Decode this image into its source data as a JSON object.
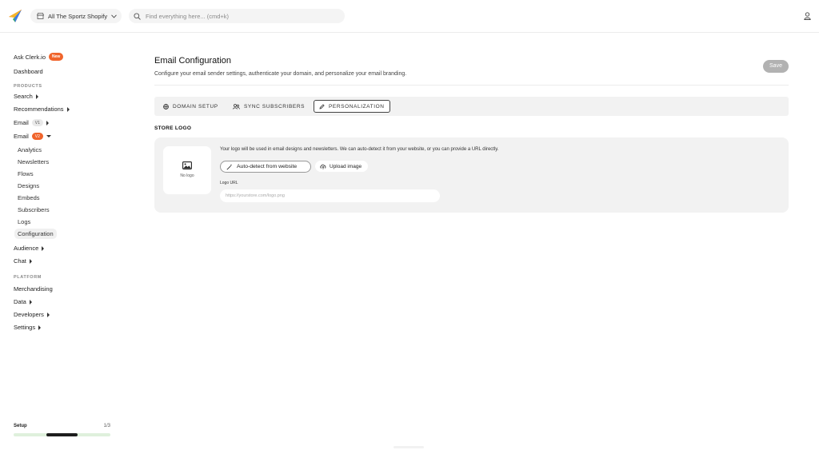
{
  "topbar": {
    "store_name": "All The Sportz Shopify",
    "search_placeholder": "Find everything here... (cmd+k)",
    "icons": {
      "logo": "paper-plane-logo",
      "store": "store-icon",
      "chevron": "chevron-down-icon",
      "search": "search-icon",
      "user": "user-icon"
    }
  },
  "sidebar": {
    "ask": {
      "label": "Ask Clerk.io",
      "badge": "New"
    },
    "dashboard": "Dashboard",
    "products_heading": "PRODUCTS",
    "search": "Search",
    "recommendations": "Recommendations",
    "email_v1": {
      "label": "Email",
      "badge": "V1"
    },
    "email_v2": {
      "label": "Email",
      "badge": "V2"
    },
    "email_sub": [
      "Analytics",
      "Newsletters",
      "Flows",
      "Designs",
      "Embeds",
      "Subscribers",
      "Logs",
      "Configuration"
    ],
    "active_item": "Configuration",
    "audience": "Audience",
    "chat": "Chat",
    "platform_heading": "PLATFORM",
    "merchandising": "Merchandising",
    "data": "Data",
    "developers": "Developers",
    "settings": "Settings",
    "setup": {
      "label": "Setup",
      "count": "1/3",
      "progress_fraction": 0.333
    }
  },
  "main": {
    "title": "Email Configuration",
    "description": "Configure your email sender settings, authenticate your domain, and personalize your email branding.",
    "save_label": "Save",
    "tabs": [
      {
        "label": "DOMAIN SETUP",
        "icon": "globe-icon"
      },
      {
        "label": "SYNC SUBSCRIBERS",
        "icon": "users-icon"
      },
      {
        "label": "PERSONALIZATION",
        "icon": "pencil-icon",
        "active": true
      }
    ],
    "store_logo": {
      "heading": "STORE LOGO",
      "no_logo": "No logo",
      "description": "Your logo will be used in email designs and newsletters. We can auto-detect it from your website, or you can provide a URL directly.",
      "auto_detect_label": "Auto-detect from website",
      "upload_label": "Upload image",
      "url_label": "Logo URL",
      "url_placeholder": "https://yourstore.com/logo.png",
      "url_value": ""
    }
  },
  "colors": {
    "accent": "#f0642b",
    "save_disabled": "#b2b2b2",
    "card_bg": "#f2f2f2",
    "progress_track": "#dff0dc",
    "progress_fill": "#1d1d1d"
  }
}
